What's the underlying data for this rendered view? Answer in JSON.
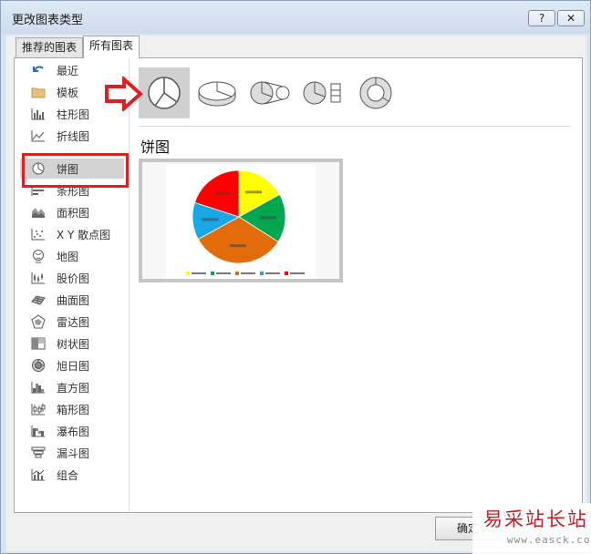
{
  "window": {
    "title": "更改图表类型",
    "help_label": "?",
    "close_label": "✕"
  },
  "tabs": [
    {
      "label": "推荐的图表"
    },
    {
      "label": "所有图表"
    }
  ],
  "categories": [
    {
      "label": "最近",
      "icon": "recent-icon"
    },
    {
      "label": "模板",
      "icon": "folder-icon"
    },
    {
      "label": "柱形图",
      "icon": "column-chart-icon"
    },
    {
      "label": "折线图",
      "icon": "line-chart-icon"
    },
    {
      "label": "饼图",
      "icon": "pie-chart-icon",
      "selected": true
    },
    {
      "label": "条形图",
      "icon": "bar-chart-icon"
    },
    {
      "label": "面积图",
      "icon": "area-chart-icon"
    },
    {
      "label": "X Y 散点图",
      "icon": "scatter-chart-icon"
    },
    {
      "label": "地图",
      "icon": "map-chart-icon"
    },
    {
      "label": "股价图",
      "icon": "stock-chart-icon"
    },
    {
      "label": "曲面图",
      "icon": "surface-chart-icon"
    },
    {
      "label": "雷达图",
      "icon": "radar-chart-icon"
    },
    {
      "label": "树状图",
      "icon": "treemap-chart-icon"
    },
    {
      "label": "旭日图",
      "icon": "sunburst-chart-icon"
    },
    {
      "label": "直方图",
      "icon": "histogram-chart-icon"
    },
    {
      "label": "箱形图",
      "icon": "box-whisker-chart-icon"
    },
    {
      "label": "瀑布图",
      "icon": "waterfall-chart-icon"
    },
    {
      "label": "漏斗图",
      "icon": "funnel-chart-icon"
    },
    {
      "label": "组合",
      "icon": "combo-chart-icon"
    }
  ],
  "subtypes": [
    {
      "icon": "pie-icon",
      "active": true
    },
    {
      "icon": "3d-pie-icon"
    },
    {
      "icon": "pie-of-pie-icon"
    },
    {
      "icon": "bar-of-pie-icon"
    },
    {
      "icon": "doughnut-icon"
    }
  ],
  "selected_type_title": "饼图",
  "preview": {
    "slices": [
      {
        "value": 17,
        "color": "#ffff00"
      },
      {
        "value": 17,
        "color": "#00a650"
      },
      {
        "value": 33,
        "color": "#e26b0a"
      },
      {
        "value": 13,
        "color": "#1aa7e6"
      },
      {
        "value": 20,
        "color": "#ff0000"
      }
    ]
  },
  "footer": {
    "ok_label": "确定"
  },
  "watermark": {
    "text": "易采站长站",
    "url": "www.easck.com"
  },
  "colors": {
    "highlight": "#e02020",
    "titlebar": "#d9e4f1"
  }
}
